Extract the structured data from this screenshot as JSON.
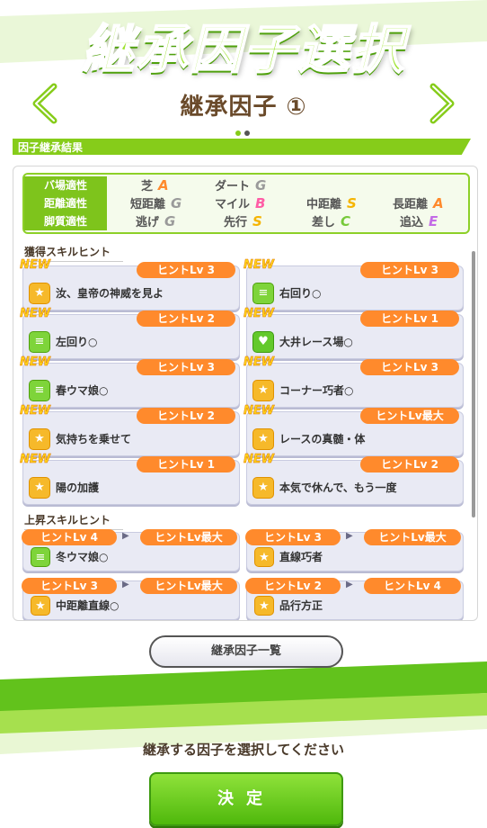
{
  "header": {
    "banner": "継承因子選択",
    "page_title": "継承因子 ①"
  },
  "section_title": "因子継承結果",
  "aptitude": {
    "rows": [
      {
        "label": "バ場適性",
        "items": [
          {
            "name": "芝",
            "grade": "A"
          },
          {
            "name": "ダート",
            "grade": "G"
          }
        ]
      },
      {
        "label": "距離適性",
        "items": [
          {
            "name": "短距離",
            "grade": "G"
          },
          {
            "name": "マイル",
            "grade": "B"
          },
          {
            "name": "中距離",
            "grade": "S"
          },
          {
            "name": "長距離",
            "grade": "A"
          }
        ]
      },
      {
        "label": "脚質適性",
        "items": [
          {
            "name": "逃げ",
            "grade": "G"
          },
          {
            "name": "先行",
            "grade": "S"
          },
          {
            "name": "差し",
            "grade": "C"
          },
          {
            "name": "追込",
            "grade": "E"
          }
        ]
      }
    ]
  },
  "acquired_title": "獲得スキルヒント",
  "acquired_skills": [
    {
      "badge": "NEW",
      "hint": "ヒントLv 3",
      "name": "汝、皇帝の神威を見よ",
      "icon": "gold"
    },
    {
      "badge": "NEW",
      "hint": "ヒントLv 3",
      "name": "右回り○",
      "icon": "green"
    },
    {
      "badge": "NEW",
      "hint": "ヒントLv 2",
      "name": "左回り○",
      "icon": "green"
    },
    {
      "badge": "NEW",
      "hint": "ヒントLv 1",
      "name": "大井レース場○",
      "icon": "greenheart"
    },
    {
      "badge": "NEW",
      "hint": "ヒントLv 3",
      "name": "春ウマ娘○",
      "icon": "green"
    },
    {
      "badge": "NEW",
      "hint": "ヒントLv 3",
      "name": "コーナー巧者○",
      "icon": "gold"
    },
    {
      "badge": "NEW",
      "hint": "ヒントLv 2",
      "name": "気持ちを乗せて",
      "icon": "gold"
    },
    {
      "badge": "NEW",
      "hint": "ヒントLv最大",
      "name": "レースの真髄・体",
      "icon": "gold"
    },
    {
      "badge": "NEW",
      "hint": "ヒントLv 1",
      "name": "陽の加護",
      "icon": "gold"
    },
    {
      "badge": "NEW",
      "hint": "ヒントLv 2",
      "name": "本気で休んで、もう一度",
      "icon": "gold"
    }
  ],
  "raised_title": "上昇スキルヒント",
  "raised_skills": [
    {
      "from": "ヒントLv 4",
      "to": "ヒントLv最大",
      "name": "冬ウマ娘○",
      "icon": "green"
    },
    {
      "from": "ヒントLv 3",
      "to": "ヒントLv最大",
      "name": "直線巧者",
      "icon": "gold"
    },
    {
      "from": "ヒントLv 3",
      "to": "ヒントLv最大",
      "name": "中距離直線○",
      "icon": "gold"
    },
    {
      "from": "ヒントLv 2",
      "to": "ヒントLv 4",
      "name": "品行方正",
      "icon": "gold"
    }
  ],
  "list_button": "継承因子一覧",
  "prompt": "継承する因子を選択してください",
  "decide_button": "決定",
  "colors": {
    "accent": "#86cc1a",
    "hint": "#ff8a2c",
    "dot_active": "#86cc1a",
    "dot_inactive": "#555555"
  }
}
